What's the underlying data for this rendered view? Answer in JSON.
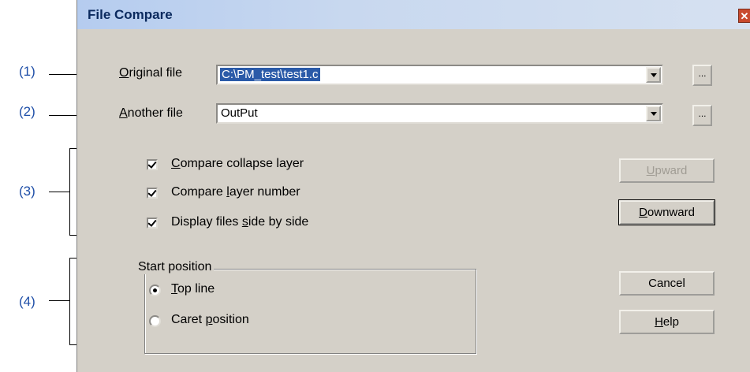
{
  "callouts": [
    "(1)",
    "(2)",
    "(3)",
    "(4)"
  ],
  "dialog": {
    "title": "File Compare",
    "close_symbol": "✕"
  },
  "original_file": {
    "label_accel": "O",
    "label_rest": "riginal file",
    "value": "C:\\PM_test\\test1.c",
    "browse": "..."
  },
  "another_file": {
    "label_accel": "A",
    "label_rest": "nother file",
    "value": "OutPut",
    "browse": "..."
  },
  "options": [
    {
      "pre": "",
      "accel": "C",
      "post": "ompare collapse layer",
      "checked": true
    },
    {
      "pre": "Compare ",
      "accel": "l",
      "post": "ayer number",
      "checked": true
    },
    {
      "pre": "Display files ",
      "accel": "s",
      "post": "ide by side",
      "checked": true
    }
  ],
  "start_position": {
    "legend": "Start position",
    "top_line": {
      "pre": "",
      "accel": "T",
      "post": "op line",
      "selected": true
    },
    "caret": {
      "pre": "Caret ",
      "accel": "p",
      "post": "osition",
      "selected": false
    }
  },
  "buttons": {
    "upward": {
      "accel": "U",
      "rest": "pward",
      "enabled": false
    },
    "downward": {
      "accel": "D",
      "rest": "ownward"
    },
    "cancel": "Cancel",
    "help": {
      "accel": "H",
      "rest": "elp"
    }
  }
}
